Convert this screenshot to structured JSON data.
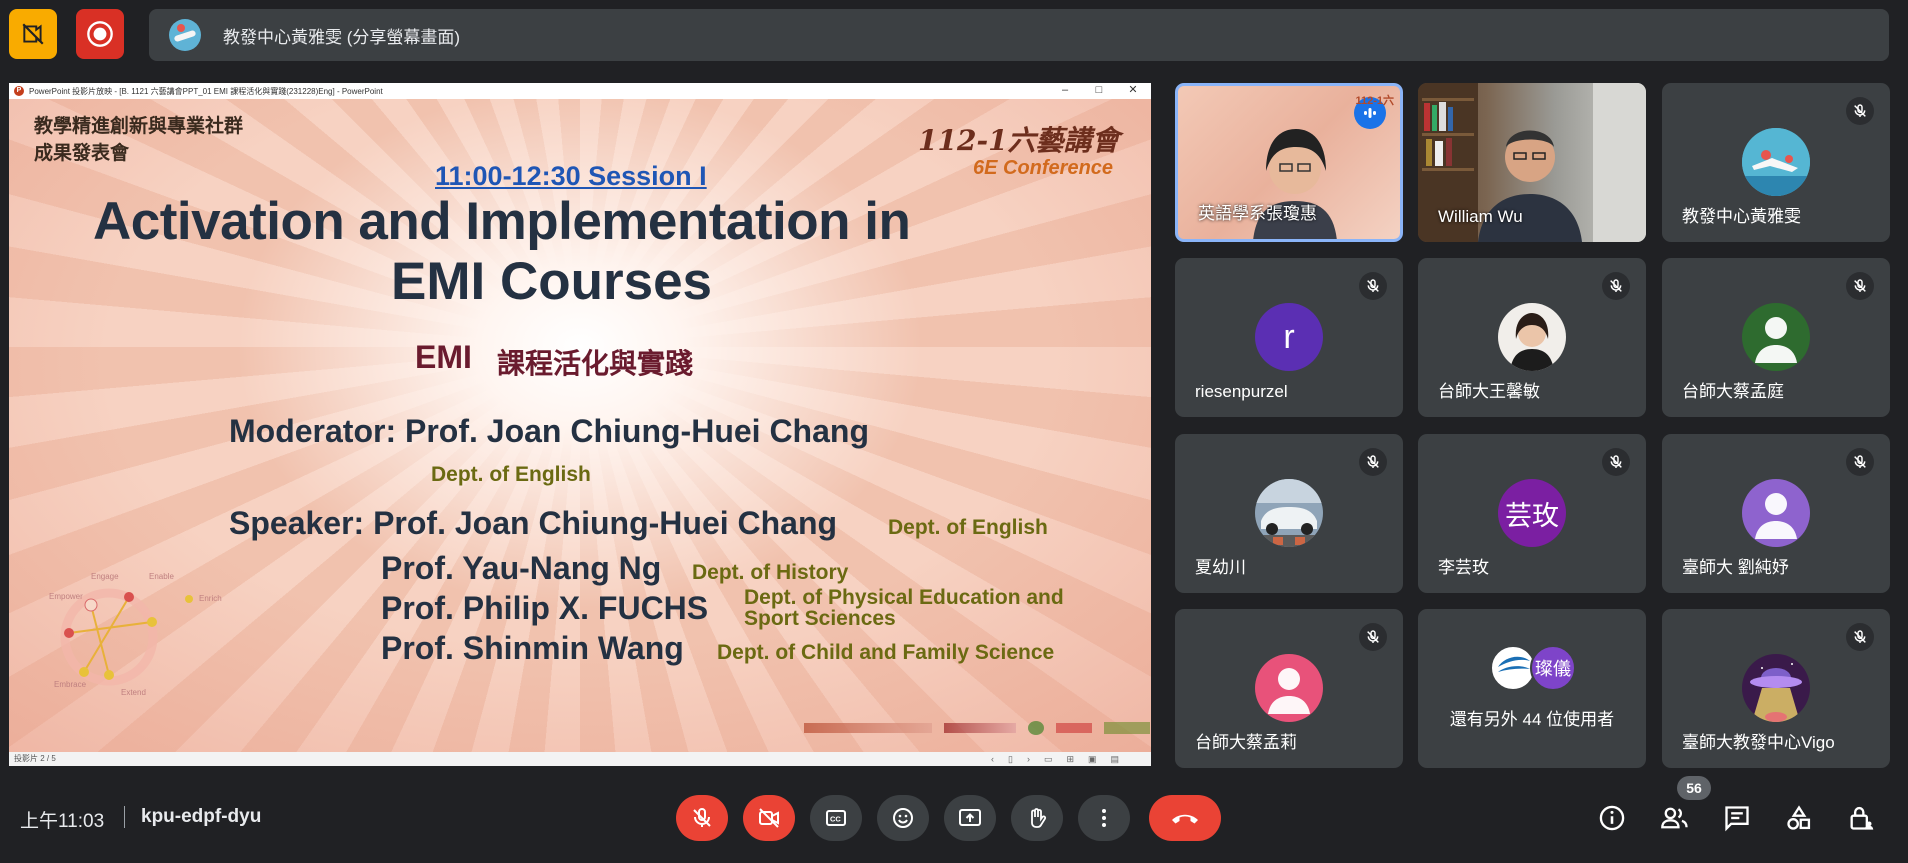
{
  "top": {
    "presenter_text": "教發中心黃雅雯 (分享螢幕畫面)"
  },
  "powerpoint": {
    "title": "PowerPoint 投影片放映 - [B. 1121 六藝講會PPT_01 EMI 課程活化與實踐(231228)Eng] - PowerPoint",
    "status": "投影片 2 / 5"
  },
  "slide": {
    "tl_line1": "教學精進創新與專業社群",
    "tl_line2": "成果發表會",
    "session": "11:00-12:30  Session I",
    "conference_title": "112-1六藝講會",
    "conference_sub": "6E Conference",
    "title_line1": "Activation and Implementation in",
    "title_line2": "EMI Courses",
    "subtitle_emi": "EMI",
    "subtitle_zh": "課程活化與實踐",
    "moderator": "Moderator: Prof. Joan Chiung-Huei Chang",
    "moderator_dept": "Dept. of English",
    "speaker1": "Speaker: Prof. Joan Chiung-Huei Chang",
    "speaker1_dept": "Dept. of English",
    "speaker2": "Prof. Yau-Nang Ng",
    "speaker2_dept": "Dept. of History",
    "speaker3": "Prof. Philip X. FUCHS",
    "speaker3_dept_line1": "Dept. of Physical Education and",
    "speaker3_dept_line2": "Sport Sciences",
    "speaker4": "Prof. Shinmin Wang",
    "speaker4_dept": "Dept. of Child and Family Science",
    "diagram_labels": [
      "Engage",
      "Enable",
      "Enrich",
      "Empower",
      "Embrace",
      "Extend"
    ]
  },
  "participants": [
    {
      "name": "英語學系張瓊惠",
      "type": "video",
      "speaking": true
    },
    {
      "name": "William Wu",
      "type": "video"
    },
    {
      "name": "教發中心黃雅雯",
      "type": "avatar",
      "muted": true
    },
    {
      "name": "riesenpurzel",
      "type": "letter",
      "letter": "r",
      "color": "#5b2fb3",
      "muted": true
    },
    {
      "name": "台師大王馨敏",
      "type": "photo",
      "muted": true
    },
    {
      "name": "台師大蔡孟庭",
      "type": "person",
      "color": "#2e6b2f",
      "muted": true
    },
    {
      "name": "夏幼川",
      "type": "photo",
      "muted": true
    },
    {
      "name": "李芸玫",
      "type": "letter",
      "letter": "芸玫",
      "color": "#7b1fa2",
      "muted": true
    },
    {
      "name": "臺師大 劉純妤",
      "type": "person",
      "color": "#8e63ce",
      "muted": true
    },
    {
      "name": "台師大蔡孟莉",
      "type": "person",
      "color": "#e8527a",
      "muted": true
    },
    {
      "name": "還有另外 44 位使用者",
      "type": "others",
      "badge": "璨儀"
    },
    {
      "name": "臺師大教發中心Vigo",
      "type": "photo",
      "muted": true
    }
  ],
  "bottom": {
    "time": "上午11:03",
    "meeting_code": "kpu-edpf-dyu",
    "people_count": "56"
  },
  "colors": {
    "background": "#202124",
    "tile": "#3c4043",
    "danger": "#ea4335",
    "warning": "#f9ab00",
    "accent": "#8ab4f8"
  }
}
